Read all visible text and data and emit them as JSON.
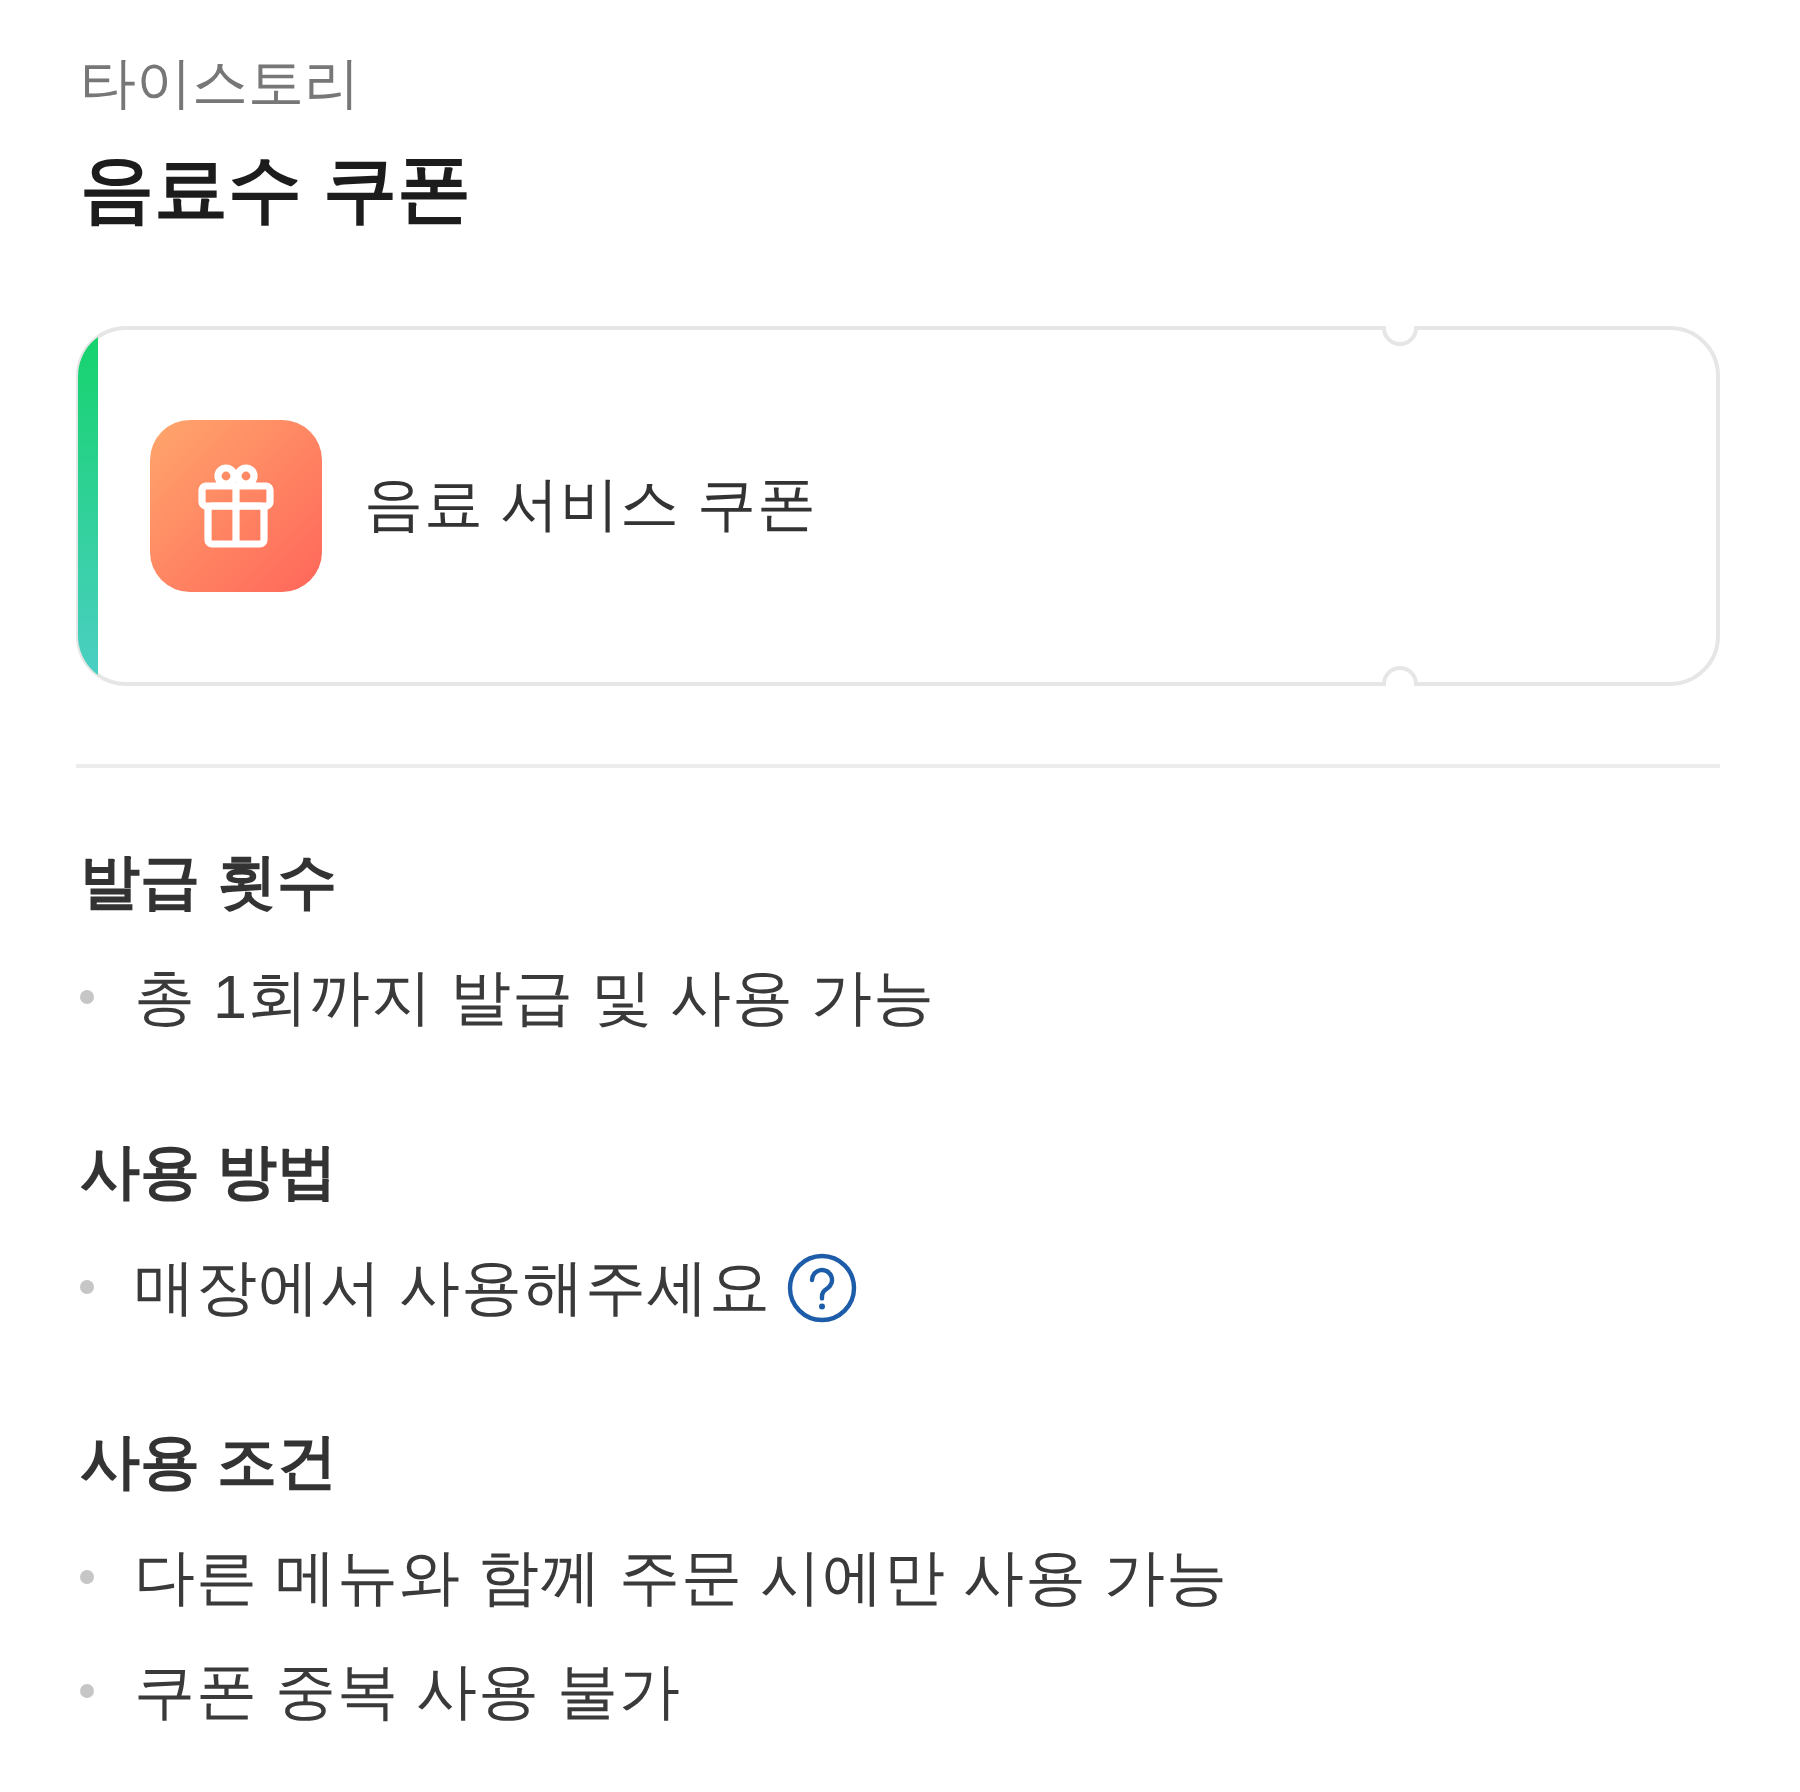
{
  "brand": "타이스토리",
  "title": "음료수 쿠폰",
  "coupon": {
    "name": "음료 서비스 쿠폰"
  },
  "sections": [
    {
      "heading": "발급 횟수",
      "items": [
        {
          "text": "총 1회까지 발급 및 사용 가능",
          "help": false
        }
      ]
    },
    {
      "heading": "사용 방법",
      "items": [
        {
          "text": "매장에서 사용해주세요",
          "help": true
        }
      ]
    },
    {
      "heading": "사용 조건",
      "items": [
        {
          "text": "다른 메뉴와 함께 주문 시에만 사용 가능",
          "help": false
        },
        {
          "text": "쿠폰 중복 사용 불가",
          "help": false
        }
      ]
    }
  ]
}
